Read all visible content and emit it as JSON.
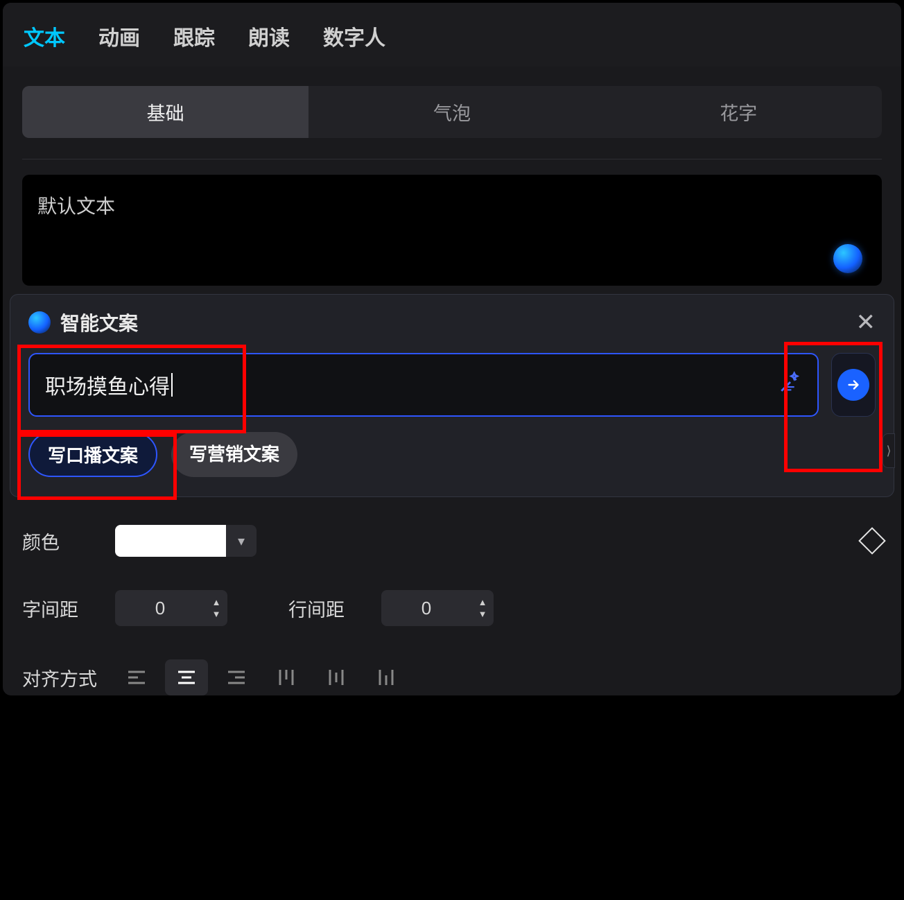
{
  "topTabs": {
    "text": "文本",
    "animation": "动画",
    "tracking": "跟踪",
    "read": "朗读",
    "avatar": "数字人"
  },
  "subTabs": {
    "basic": "基础",
    "bubble": "气泡",
    "fancy": "花字"
  },
  "textBox": {
    "placeholder": "默认文本"
  },
  "popup": {
    "title": "智能文案",
    "input": "职场摸鱼心得",
    "chipPrimary": "写口播文案",
    "chipSecondary": "写营销文案"
  },
  "controls": {
    "colorLabel": "颜色",
    "colorValue": "#FFFFFF",
    "letterSpacingLabel": "字间距",
    "letterSpacingValue": "0",
    "lineSpacingLabel": "行间距",
    "lineSpacingValue": "0",
    "alignLabel": "对齐方式"
  }
}
